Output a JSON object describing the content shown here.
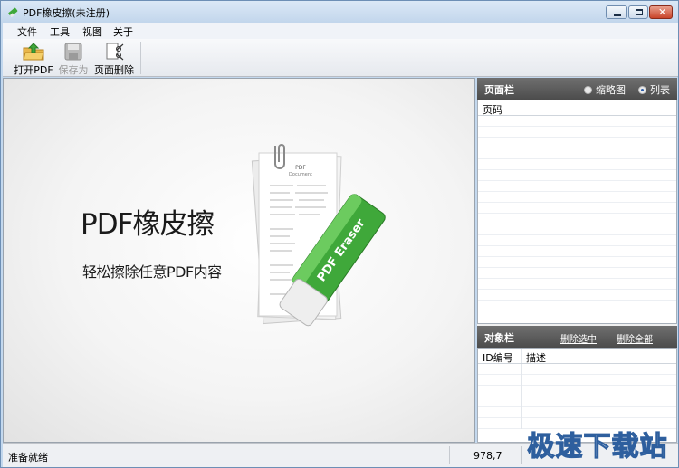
{
  "window": {
    "title": "PDF橡皮擦(未注册)"
  },
  "menu": {
    "items": [
      "文件",
      "工具",
      "视图",
      "关于"
    ]
  },
  "toolbar": {
    "open_label": "打开PDF",
    "save_label": "保存为",
    "delete_page_label": "页面删除"
  },
  "hero": {
    "title": "PDF橡皮擦",
    "subtitle": "轻松擦除任意PDF内容",
    "eraser_text": "PDF Eraser",
    "doc_title_1": "PDF",
    "doc_title_2": "Document"
  },
  "pages_panel": {
    "title": "页面栏",
    "radio_thumbnail": "缩略图",
    "radio_list": "列表",
    "selected_view": "列表",
    "column_header": "页码"
  },
  "objects_panel": {
    "title": "对象栏",
    "delete_selected": "删除选中",
    "delete_all": "删除全部",
    "col_id": "ID编号",
    "col_desc": "描述"
  },
  "status": {
    "text": "准备就绪",
    "coords": "978,7"
  },
  "watermark": {
    "text": "极速下载站"
  },
  "colors": {
    "panel_header": "#5a5a5a",
    "eraser_green": "#3fa83a",
    "close_button": "#c9442a"
  }
}
